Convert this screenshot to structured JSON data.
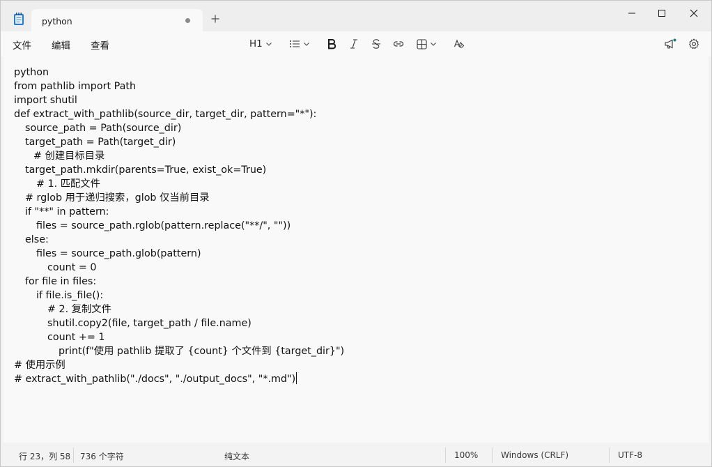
{
  "tab": {
    "title": "python"
  },
  "menu": {
    "file": "文件",
    "edit": "编辑",
    "view": "查看"
  },
  "toolbar": {
    "heading_label": "H1"
  },
  "editor": {
    "lines": [
      {
        "indent": 0,
        "text": "python"
      },
      {
        "indent": 0,
        "text": "from pathlib import Path"
      },
      {
        "indent": 0,
        "text": "import shutil"
      },
      {
        "indent": 0,
        "text": "def extract_with_pathlib(source_dir, target_dir, pattern=\"*\"):"
      },
      {
        "indent": 1,
        "text": "source_path = Path(source_dir)"
      },
      {
        "indent": 1,
        "text": "target_path = Path(target_dir)"
      },
      {
        "indent": 1.75,
        "text": "# 创建目标目录"
      },
      {
        "indent": 1,
        "text": "target_path.mkdir(parents=True, exist_ok=True)"
      },
      {
        "indent": 2,
        "text": "# 1. 匹配文件"
      },
      {
        "indent": 1,
        "text": "# rglob 用于递归搜索，glob 仅当前目录"
      },
      {
        "indent": 1,
        "text": "if \"**\" in pattern:"
      },
      {
        "indent": 2,
        "text": "files = source_path.rglob(pattern.replace(\"**/\", \"\"))"
      },
      {
        "indent": 1,
        "text": "else:"
      },
      {
        "indent": 2,
        "text": "files = source_path.glob(pattern)"
      },
      {
        "indent": 3,
        "text": "count = 0"
      },
      {
        "indent": 1,
        "text": "for file in files:"
      },
      {
        "indent": 2,
        "text": "if file.is_file():"
      },
      {
        "indent": 3,
        "text": "# 2. 复制文件"
      },
      {
        "indent": 3,
        "text": "shutil.copy2(file, target_path / file.name)"
      },
      {
        "indent": 3,
        "text": "count += 1"
      },
      {
        "indent": 4,
        "text": "print(f\"使用 pathlib 提取了 {count} 个文件到 {target_dir}\")"
      },
      {
        "indent": 0,
        "text": "# 使用示例"
      },
      {
        "indent": 0,
        "text": "# extract_with_pathlib(\"./docs\", \"./output_docs\", \"*.md\")"
      }
    ]
  },
  "status": {
    "position": "行 23，列 58",
    "char_count": "736 个字符",
    "format": "纯文本",
    "zoom": "100%",
    "line_ending": "Windows (CRLF)",
    "encoding": "UTF-8"
  }
}
